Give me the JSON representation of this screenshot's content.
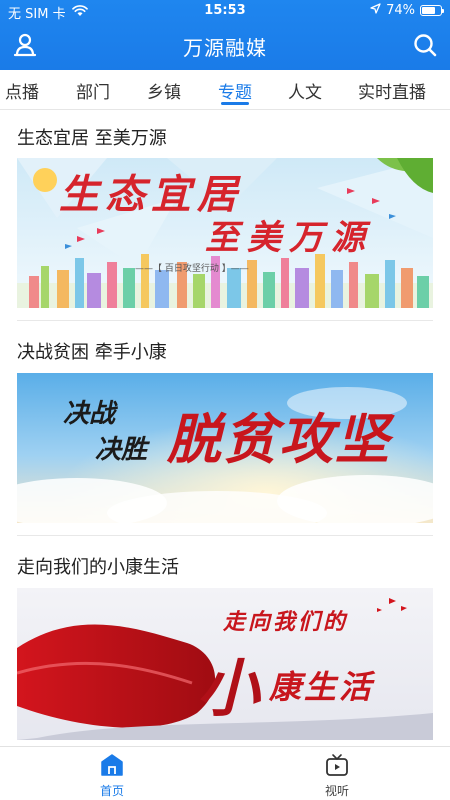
{
  "status_bar": {
    "carrier": "无 SIM 卡",
    "time": "15:53",
    "battery": "74%",
    "battery_level": 0.74
  },
  "app": {
    "title": "万源融媒",
    "colors": {
      "primary": "#1a7be8",
      "text": "#222222"
    }
  },
  "tabs": [
    {
      "label": "点播"
    },
    {
      "label": "部门"
    },
    {
      "label": "乡镇"
    },
    {
      "label": "专题",
      "active": true
    },
    {
      "label": "人文"
    },
    {
      "label": "实时直播"
    }
  ],
  "sections": [
    {
      "title": "生态宜居 至美万源",
      "banner": {
        "line1": "生态宜居",
        "line2": "至美万源",
        "caption": "——【 百日攻坚行动 】——"
      }
    },
    {
      "title": "决战贫困 牵手小康",
      "banner": {
        "line1": "决战",
        "line2": "决胜",
        "headline": "脱贫攻坚"
      }
    },
    {
      "title": "走向我们的小康生活",
      "banner": {
        "line1": "走向我们的",
        "big": "小",
        "line2": "康生活"
      }
    }
  ],
  "bottom_nav": [
    {
      "label": "首页",
      "icon": "home-icon",
      "active": true
    },
    {
      "label": "视听",
      "icon": "tv-icon",
      "active": false
    }
  ]
}
